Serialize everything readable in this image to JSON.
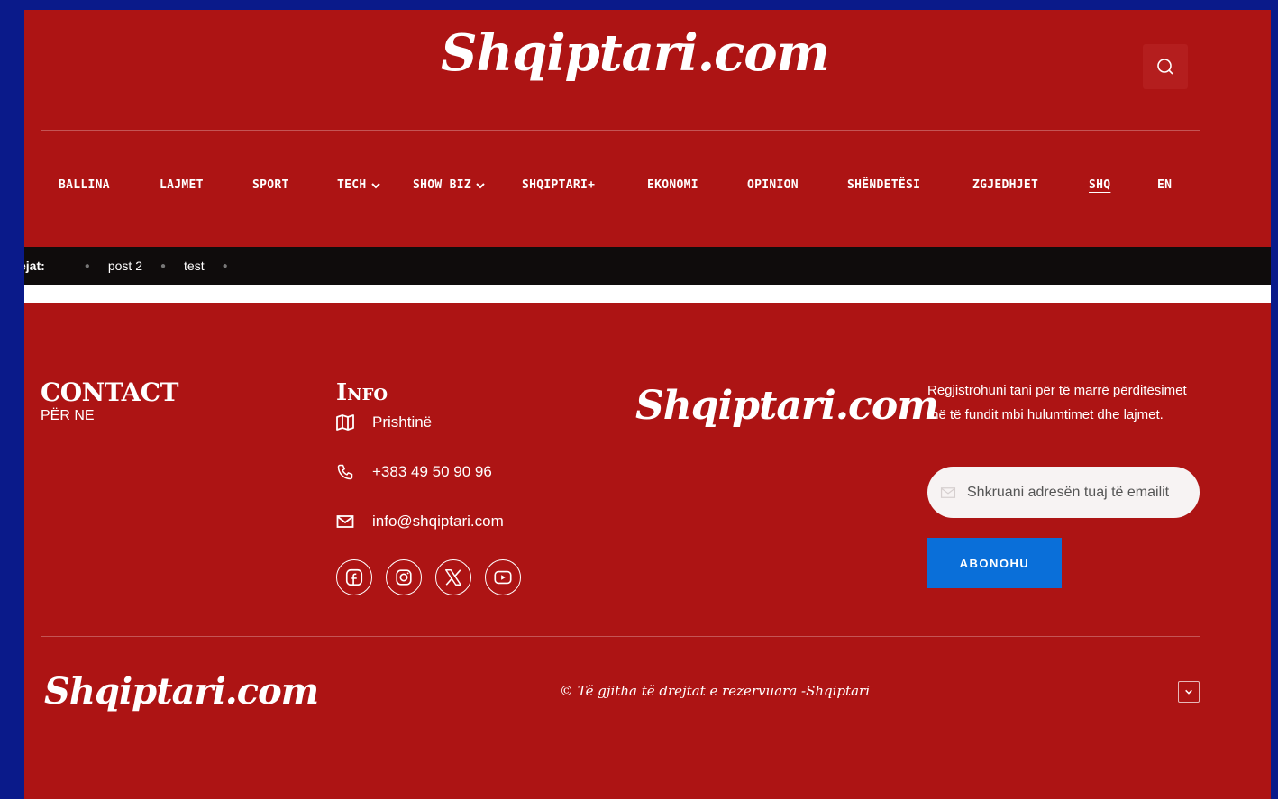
{
  "header": {
    "logo": "Shqiptari.com",
    "nav": [
      {
        "label": "BALLINA",
        "dropdown": false,
        "active": false
      },
      {
        "label": "LAJMET",
        "dropdown": false,
        "active": false
      },
      {
        "label": "SPORT",
        "dropdown": false,
        "active": false
      },
      {
        "label": "TECH",
        "dropdown": true,
        "active": false
      },
      {
        "label": "SHOW BIZ",
        "dropdown": true,
        "active": false
      },
      {
        "label": "SHQIPTARI+",
        "dropdown": false,
        "active": false
      },
      {
        "label": "EKONOMI",
        "dropdown": false,
        "active": false
      },
      {
        "label": "OPINION",
        "dropdown": false,
        "active": false
      },
      {
        "label": "SHËNDETËSI",
        "dropdown": false,
        "active": false
      },
      {
        "label": "ZGJEDHJET",
        "dropdown": false,
        "active": false
      },
      {
        "label": "SHQ",
        "dropdown": false,
        "active": true
      },
      {
        "label": "EN",
        "dropdown": false,
        "active": false
      }
    ]
  },
  "ticker": {
    "title": "ejat:",
    "items": [
      "post 2",
      "test"
    ]
  },
  "footer": {
    "contact": {
      "title": "CONTACT",
      "subtitle": "PËR NE"
    },
    "info": {
      "title": "Info",
      "location": "Prishtinë",
      "phone": "+383 49 50 90 96",
      "email": "info@shqiptari.com"
    },
    "socials": [
      "facebook-icon",
      "instagram-icon",
      "x-icon",
      "youtube-icon"
    ],
    "logo_mid": "Shqiptari.com",
    "newsletter": {
      "text": "Regjistrohuni tani për të marrë përditësimet më të fundit mbi hulumtimet dhe lajmet.",
      "email_placeholder": "Shkruani adresën tuaj të emailit",
      "button": "ABONOHU"
    },
    "logo_bottom": "Shqiptari.com",
    "copyright": "© Të gjitha të drejtat e rezervuara -Shqiptari"
  },
  "colors": {
    "brand_red": "#ad1414",
    "outer_blue": "#0a1a8a",
    "ticker_bg": "#0f0c0c",
    "button_blue": "#0a6fd9"
  }
}
